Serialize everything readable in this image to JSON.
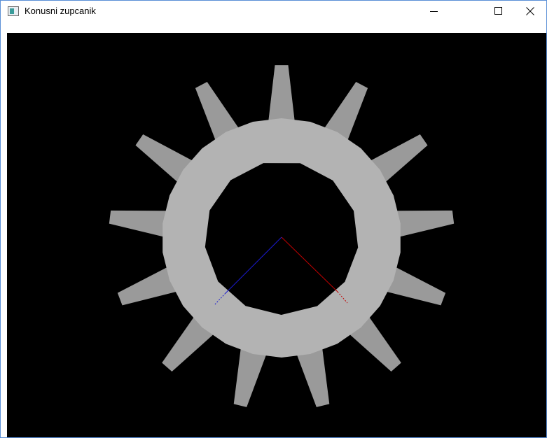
{
  "window": {
    "title": "Konusni zupcanik",
    "controls": {
      "minimize": "minimize",
      "maximize": "maximize",
      "close": "close"
    }
  },
  "scene": {
    "background_color": "#000000",
    "gear": {
      "teeth_count": 13,
      "tooth_color": "#9a9a9a",
      "ring_color": "#b3b3b3",
      "hole_color": "#000000"
    },
    "axes": {
      "x_axis_color": "#c00000",
      "z_axis_color": "#1a1ad0"
    }
  }
}
